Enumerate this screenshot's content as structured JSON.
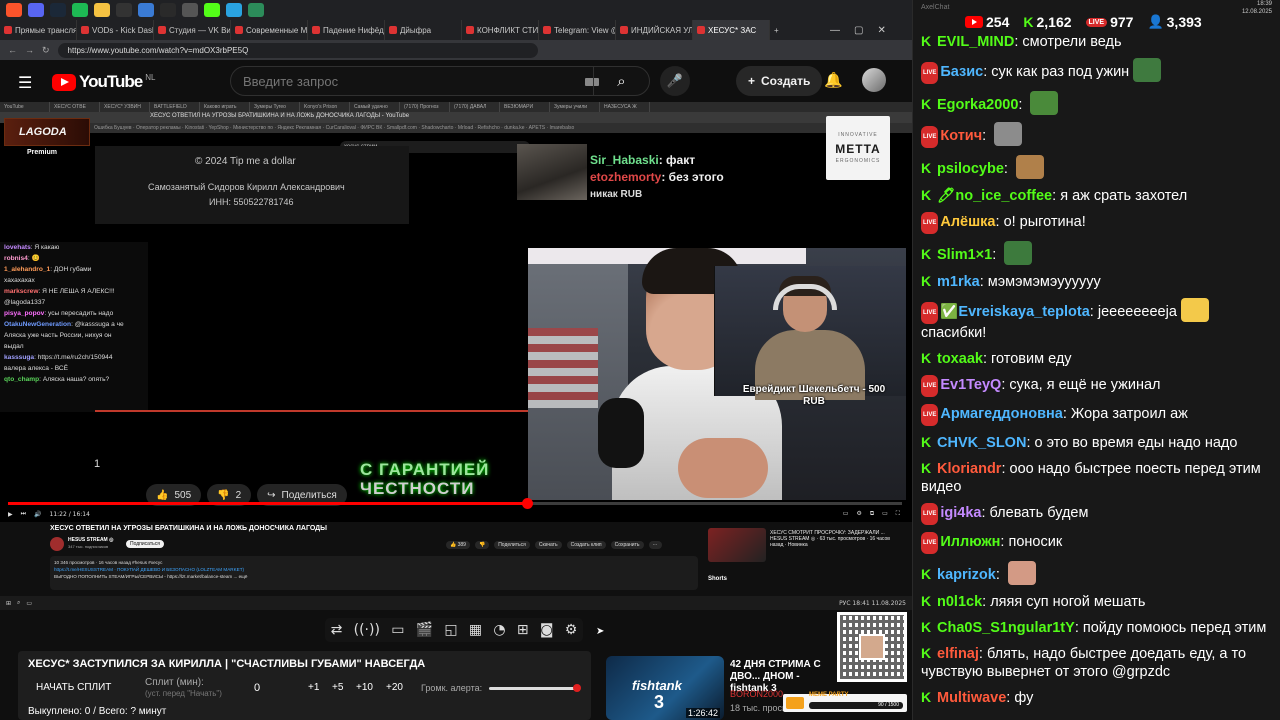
{
  "os": {
    "top_icons": [
      "brave",
      "discord",
      "steam",
      "spotify",
      "explorer",
      "x",
      "app",
      "app",
      "obs",
      "kick",
      "telegram",
      "grid"
    ]
  },
  "browser": {
    "tabs": [
      {
        "label": "Прямые трансляции",
        "active": false
      },
      {
        "label": "VODs - Kick Dashboard",
        "active": false
      },
      {
        "label": "Студия — VK Видео",
        "active": false
      },
      {
        "label": "Современные Мальчики",
        "active": false
      },
      {
        "label": "Падение Нифёдова",
        "active": false
      },
      {
        "label": "Дйыфра",
        "active": false
      },
      {
        "label": "КОНФЛИКТ СТИНТ",
        "active": false
      },
      {
        "label": "Telegram: View @m",
        "active": false
      },
      {
        "label": "ИНДИЙСКАЯ УЛИЦ",
        "active": false
      },
      {
        "label": "ХЕСУС* ЗАС",
        "active": true
      }
    ],
    "url": "https://www.youtube.com/watch?v=mdOX3rbPE5Q"
  },
  "youtube": {
    "logo": "YouTube",
    "region": "NL",
    "search_placeholder": "Введите запрос",
    "create_label": "Создать"
  },
  "video": {
    "inner_tabs": [
      "YouTube",
      "ХЕСУС ОТВЕ",
      "ХЕСУС* УЗВИН",
      "BATTLEFIELD",
      "Каково играть",
      "Зумеры Tyreo",
      "Konyo's Prison",
      "Самый удачно",
      "(7170) Прогноз",
      "(7170) ДАВАЛ",
      "ВЕЗЮМАРИ",
      "Зумеры учили",
      "НАЗЕСУСА Ж"
    ],
    "inner_title": "ХЕСУС ОТВЕТИЛ НА УГРОЗЫ БРАТИШКИНА И НА ЛОЖЬ ДОНОСЧИКА ЛАГОДЫ - YouTube",
    "inner_bookmarks": "Ошибка Бушуев · Оператор рекламы · Kinostati · YepShop · Министерство по · Яндекс Рекламная · CurCaralioval · ФИРС ВК · Smallpdf.com · Shadowcharto · Mrload · Refishcho · dunka.ke · APETS · Imarebalso",
    "lagoda_logo": "LAGODA",
    "lagoda_premium": "Premium",
    "inner_search": "хесус стрим",
    "tip": {
      "line1": "© 2024 Tip me a dollar",
      "line2": "Самозанятый Сидоров Кирилл Александрович",
      "line3": "ИНН: 550522781746"
    },
    "overlay_chat": [
      {
        "user": "Sir_Habaski",
        "text": ": факт"
      },
      {
        "user": "etozhemorty",
        "text": ": без этого"
      },
      {
        "user": "",
        "text": "никак RUB"
      }
    ],
    "sponsor": {
      "top": "INNOVATIVE",
      "name": "METTA",
      "bottom": "ERGONOMICS"
    },
    "left_chat": [
      {
        "user": "lovehats",
        "text": ": Я какаю",
        "color": "#c48aff"
      },
      {
        "user": "robnis4",
        "text": ": 😊",
        "color": "#ff9bd0"
      },
      {
        "user": "1_alehandro_1",
        "text": ": ДОН губами",
        "color": "#ff9b58"
      },
      {
        "user": "",
        "text": "хахахахах",
        "color": "#ddd"
      },
      {
        "user": "markscrew",
        "text": ": Я НЕ ЛЕША Я АЛЕКС!!!",
        "color": "#ff7070"
      },
      {
        "user": "",
        "text": "@lagoda1337",
        "color": "#ddd"
      },
      {
        "user": "pisya_popov",
        "text": ": усы пересадить надо",
        "color": "#ff6fff"
      },
      {
        "user": "OtakuNewGeneration",
        "text": ": @kasssuga а че",
        "color": "#6f9bff"
      },
      {
        "user": "",
        "text": "Аляска уже часть России, нихуя он",
        "color": "#ddd"
      },
      {
        "user": "",
        "text": "выдал",
        "color": "#ddd"
      },
      {
        "user": "kasssuga",
        "text": ": https://t.me/ru2ch/150944",
        "color": "#a0a0ff"
      },
      {
        "user": "",
        "text": "валера алекса - ВСЁ",
        "color": "#ddd"
      },
      {
        "user": "qto_champ",
        "text": ": Аляска наша? опять?",
        "color": "#5ad45a"
      }
    ],
    "left_count": "1",
    "donation_line1": "Еврейдикт Шекельбетч - 500",
    "donation_line2": "RUB",
    "guarantee_line1": "С ГАРАНТИЕЙ",
    "guarantee_line2": "ЧЕСТНОСТИ",
    "likes": "505",
    "dislikes": "2",
    "share": "Поделиться",
    "progress": 0.58,
    "time": "11:22 / 16:14"
  },
  "under": {
    "title": "ХЕСУС ОТВЕТИЛ НА УГРОЗЫ БРАТИШКИНА И НА ЛОЖЬ ДОНОСЧИКА ЛАГОДЫ",
    "channel": "HESUS STREAM ◎",
    "subs": "347 тыс. подписчиков",
    "subscribe": "Подписаться",
    "actions": [
      "👍 389",
      "👎",
      "Поделиться",
      "Скачать",
      "Создать клип",
      "Сохранить",
      "···"
    ],
    "desc_line1": "10 346 просмотров · 16 часов назад  #hesus #хесус",
    "desc_link": "https://t.me/HESUSSTREAM  · ПОКУПАЙ ДЕШЕВО И БЕЗОПАСНО (LOLZTEAM MARKET)",
    "desc_line3": "ВЫГОДНО ПОПОЛНИТЬ STEAM/ИГРЫ/СЕРВИСЫ - https://lzt.market/balance-steam ... ещё",
    "side_title": "ХЕСУС СМОТРИТ ПРОСРОЧКУ: ЗАДЕРЖАЛИ ... HESUS STREAM ◎ · 63 тыс. просмотров · 16 часов назад · Новинка",
    "shorts": "Shorts",
    "inner_clock": "РУС 18:41 11.08.2025"
  },
  "toolbar": {
    "icons": [
      "repeat-icon",
      "broadcast-icon",
      "camera-icon",
      "clapper-icon",
      "crop-icon",
      "frame-icon",
      "speed-icon",
      "add-icon",
      "photo-icon",
      "settings-icon"
    ],
    "glyphs": [
      "⇄",
      "((·))",
      "▭",
      "🎬",
      "◱",
      "▦",
      "◔",
      "⊞",
      "◙",
      "⚙"
    ]
  },
  "split": {
    "title": "ХЕСУС* ЗАСТУПИЛСЯ ЗА КИРИЛЛА | \"СЧАСТЛИВЫ ГУБАМИ\" НАВСЕГДА",
    "start": "НАЧАТЬ СПЛИТ",
    "label": "Сплит (мин):",
    "sublabel": "(уст. перед \"Начать\")",
    "zero": "0",
    "incs": [
      "+1",
      "+5",
      "+10",
      "+20"
    ],
    "alert_label": "Громк. алерта:",
    "alert_level": 1.0,
    "bought": "Выкуплено: 0 / Всего: ? минут"
  },
  "rec": {
    "title": "42 ДНЯ СТРИМА С ДВО... ДНОМ - fishtank 3",
    "channel": "BORON2000",
    "views": "18 тыс. просм...",
    "thumb_text": "fishtank",
    "thumb_num": "3",
    "duration": "1:26:42"
  },
  "meme": {
    "label": "MEME PARTY",
    "progress_text": "90 / 1500"
  },
  "chat": {
    "titlebar": "AxelChat",
    "clock": "18:39\n12.08.2025",
    "stats": {
      "youtube": "254",
      "kick": "2,162",
      "live": "977",
      "viewers": "3,393"
    },
    "messages": [
      {
        "platform": "kick",
        "user": "EVIL_MIND",
        "color": "#53fc18",
        "text": "смотрели ведь",
        "emote": ""
      },
      {
        "platform": "live",
        "user": "Базис",
        "color": "#4fb7ff",
        "text": "сук как раз под ужин",
        "emote": "#3f7a3f"
      },
      {
        "platform": "kick",
        "user": "Egorka2000",
        "color": "#53fc18",
        "text": "",
        "emote": "#4a8a3a"
      },
      {
        "platform": "live",
        "user": "Котич",
        "color": "#ff5a3c",
        "text": "",
        "emote": "#8c8c8c"
      },
      {
        "platform": "kick",
        "user": "psilocybe",
        "color": "#53fc18",
        "text": "",
        "emote": "#b0804a"
      },
      {
        "platform": "kick",
        "user": "🖊no_ice_coffee",
        "color": "#53fc18",
        "text": "я аж срать захотел",
        "emote": ""
      },
      {
        "platform": "live",
        "user": "Алёшка",
        "color": "#ffc93c",
        "text": "о! рыготина!",
        "emote": ""
      },
      {
        "platform": "kick",
        "user": "Slim1×1",
        "color": "#53fc18",
        "text": "",
        "emote": "#3d7a3d"
      },
      {
        "platform": "kick",
        "user": "m1rka",
        "color": "#4fb7ff",
        "text": "мэмэмэмэуууууу",
        "emote": ""
      },
      {
        "platform": "live",
        "user": "✅Evreiskaya_teplota",
        "color": "#4fb7ff",
        "text": "jeeeeeeeeja",
        "emote": "#f3c94a",
        "text2": "спасибки!"
      },
      {
        "platform": "kick",
        "user": "toxaak",
        "color": "#53fc18",
        "text": "готовим еду",
        "emote": ""
      },
      {
        "platform": "live",
        "user": "Ev1TeyQ",
        "color": "#c48aff",
        "text": "сука, я ещё не ужинал",
        "emote": ""
      },
      {
        "platform": "live",
        "user": "Армагеддоновна",
        "color": "#4fb7ff",
        "text": "Жора затроил аж",
        "emote": ""
      },
      {
        "platform": "kick",
        "user": "CHVK_SLON",
        "color": "#4fb7ff",
        "text": "о это во время еды надо надо",
        "emote": ""
      },
      {
        "platform": "kick",
        "user": "Kloriandr",
        "color": "#ff5a3c",
        "text": "ооо надо быстрее поесть перед этим видео",
        "emote": ""
      },
      {
        "platform": "live",
        "user": "igi4ka",
        "color": "#c48aff",
        "text": "блевать будем",
        "emote": ""
      },
      {
        "platform": "live",
        "user": "Иллюжн",
        "color": "#53fc18",
        "text": "поносик",
        "emote": ""
      },
      {
        "platform": "kick",
        "user": "kaprizok",
        "color": "#4fb7ff",
        "text": "",
        "emote": "#d39a85"
      },
      {
        "platform": "kick",
        "user": "n0l1ck",
        "color": "#53fc18",
        "text": "ляяя суп ногой мешать",
        "emote": ""
      },
      {
        "platform": "kick",
        "user": "Cha0S_S1ngular1tY",
        "color": "#53fc18",
        "text": "пойду помоюсь перед этим",
        "emote": ""
      },
      {
        "platform": "kick",
        "user": "elfinaj",
        "color": "#ff5a3c",
        "text": "блять, надо быстрее доедать еду, а то чувствую вывернет от этого @grpzdc",
        "emote": ""
      },
      {
        "platform": "kick",
        "user": "Multiwave",
        "color": "#ff5a3c",
        "text": "фу",
        "emote": ""
      }
    ]
  }
}
